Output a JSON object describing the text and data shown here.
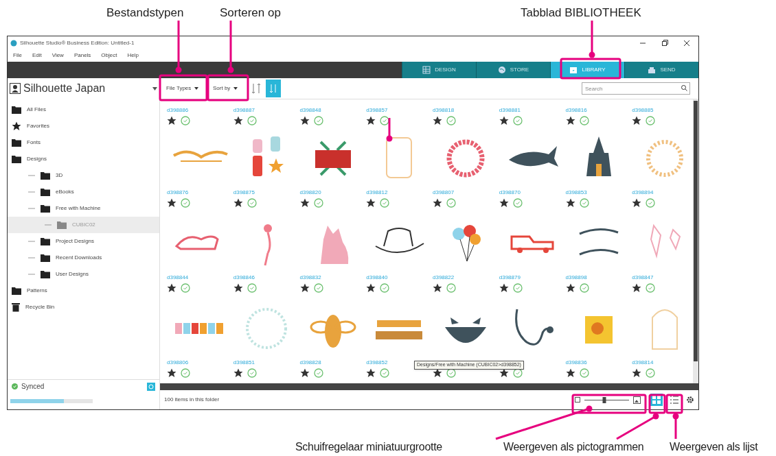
{
  "callouts": {
    "top": [
      "Bestandstypen",
      "Sorteren op",
      "Tabblad BIBLIOTHEEK"
    ],
    "bottom": [
      "Schuifregelaar miniatuurgrootte",
      "Weergeven als pictogrammen",
      "Weergeven als lijst"
    ]
  },
  "window": {
    "title": "Silhouette Studio® Business Edition: Untitled-1"
  },
  "menu": [
    "File",
    "Edit",
    "View",
    "Panels",
    "Object",
    "Help"
  ],
  "tabs": [
    {
      "label": "DESIGN",
      "selected": false
    },
    {
      "label": "STORE",
      "selected": false
    },
    {
      "label": "LIBRARY",
      "selected": true
    },
    {
      "label": "SEND",
      "selected": false
    }
  ],
  "account": {
    "name": "Silhouette Japan"
  },
  "toolbar": {
    "file_types": "File Types",
    "sort_by": "Sort by"
  },
  "search": {
    "placeholder": "Search"
  },
  "sidebar": {
    "items": [
      {
        "label": "All Files",
        "kind": "folder",
        "selected": false
      },
      {
        "label": "Favorites",
        "kind": "favorites",
        "selected": false
      },
      {
        "label": "Fonts",
        "kind": "folder",
        "selected": false
      },
      {
        "label": "Designs",
        "kind": "folder",
        "selected": false,
        "children": [
          {
            "label": "3D",
            "kind": "folder",
            "selected": false
          },
          {
            "label": "eBooks",
            "kind": "folder",
            "selected": false
          },
          {
            "label": "Free with Machine",
            "kind": "folder",
            "selected": false,
            "children": [
              {
                "label": "CUBIC02",
                "kind": "folder",
                "selected": true
              }
            ]
          },
          {
            "label": "Project Designs",
            "kind": "folder",
            "selected": false
          },
          {
            "label": "Recent Downloads",
            "kind": "folder",
            "selected": false
          },
          {
            "label": "User Designs",
            "kind": "folder",
            "selected": false
          }
        ]
      },
      {
        "label": "Patterns",
        "kind": "folder",
        "selected": false
      },
      {
        "label": "Recycle Bin",
        "kind": "trash",
        "selected": false
      }
    ],
    "sync": {
      "label": "Synced"
    },
    "storage": {
      "level": 0.65
    }
  },
  "grid": {
    "rows": [
      {
        "cropped": true,
        "items": [
          {
            "id": "d398886"
          },
          {
            "id": "d398887"
          },
          {
            "id": "d398848"
          },
          {
            "id": "d398857"
          },
          {
            "id": "d398818"
          },
          {
            "id": "d398881"
          },
          {
            "id": "d398816"
          },
          {
            "id": "d398885"
          }
        ]
      },
      {
        "cropped": false,
        "items": [
          {
            "id": "d398876"
          },
          {
            "id": "d398875"
          },
          {
            "id": "d398820"
          },
          {
            "id": "d398812"
          },
          {
            "id": "d398807"
          },
          {
            "id": "d398870"
          },
          {
            "id": "d398853"
          },
          {
            "id": "d398894"
          }
        ]
      },
      {
        "cropped": false,
        "items": [
          {
            "id": "d398844"
          },
          {
            "id": "d398846"
          },
          {
            "id": "d398832"
          },
          {
            "id": "d398840"
          },
          {
            "id": "d398822"
          },
          {
            "id": "d398879"
          },
          {
            "id": "d398898"
          },
          {
            "id": "d398847"
          }
        ]
      },
      {
        "cropped": false,
        "items": [
          {
            "id": "d398806"
          },
          {
            "id": "d398851"
          },
          {
            "id": "d398828"
          },
          {
            "id": "d398852"
          },
          {
            "covered": true
          },
          {
            "covered": true
          },
          {
            "id": "d398836"
          },
          {
            "id": "d398814"
          }
        ]
      }
    ],
    "tooltip": "Designs/Free with Machine (CUBIC02>d398852)"
  },
  "status_bar": {
    "text": "100 items in this folder",
    "thumbnail_size": {
      "level": 0.45
    },
    "views": [
      {
        "kind": "grid",
        "selected": true
      },
      {
        "kind": "list",
        "selected": false
      }
    ]
  }
}
